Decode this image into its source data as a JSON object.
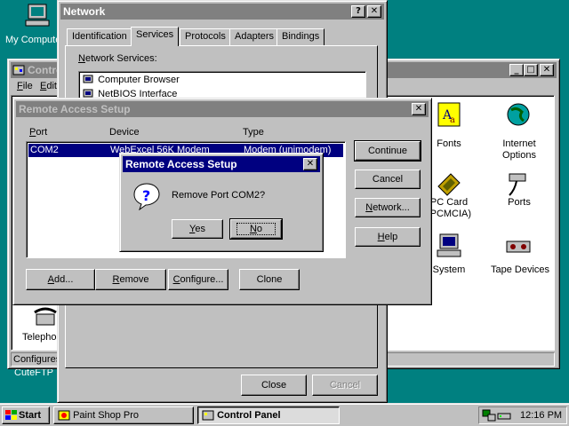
{
  "desktop": {
    "my_computer_label": "My Compute",
    "cuteftp_label": "CuteFTP"
  },
  "control_panel": {
    "title": "Contro",
    "menu": [
      "File",
      "Edit"
    ],
    "status": "Configures",
    "items": [
      {
        "label": "Fonts",
        "icon": "fonts-icon"
      },
      {
        "label": "Internet Options",
        "icon": "internet-options-icon"
      },
      {
        "label": "PC Card (PCMCIA)",
        "icon": "pc-card-icon"
      },
      {
        "label": "Ports",
        "icon": "ports-icon"
      },
      {
        "label": "System",
        "icon": "system-icon"
      },
      {
        "label": "Tape Devices",
        "icon": "tape-devices-icon"
      },
      {
        "label": "Telepho",
        "icon": "telephony-icon"
      }
    ]
  },
  "network": {
    "title": "Network",
    "tabs": [
      "Identification",
      "Services",
      "Protocols",
      "Adapters",
      "Bindings"
    ],
    "active_tab": "Services",
    "services_label": "Network Services:",
    "services": [
      "Computer Browser",
      "NetBIOS Interface"
    ],
    "close": "Close",
    "cancel": "Cancel"
  },
  "ras": {
    "title": "Remote Access Setup",
    "columns": [
      "Port",
      "Device",
      "Type"
    ],
    "rows": [
      {
        "port": "COM2",
        "device": "WebExcel 56K Modem",
        "type": "Modem (unimodem)"
      }
    ],
    "buttons_right": [
      "Continue",
      "Cancel",
      "Network...",
      "Help"
    ],
    "buttons_bottom": [
      "Add...",
      "Remove",
      "Configure...",
      "Clone"
    ]
  },
  "msgbox": {
    "title": "Remote Access Setup",
    "message": "Remove Port COM2?",
    "yes": "Yes",
    "no": "No"
  },
  "taskbar": {
    "start": "Start",
    "tasks": [
      {
        "label": "Paint Shop Pro",
        "active": false
      },
      {
        "label": "Control Panel",
        "active": true
      }
    ],
    "clock": "12:16 PM"
  },
  "colors": {
    "desktop": "#008080",
    "titlebar": "#000080",
    "face": "#c0c0c0"
  }
}
